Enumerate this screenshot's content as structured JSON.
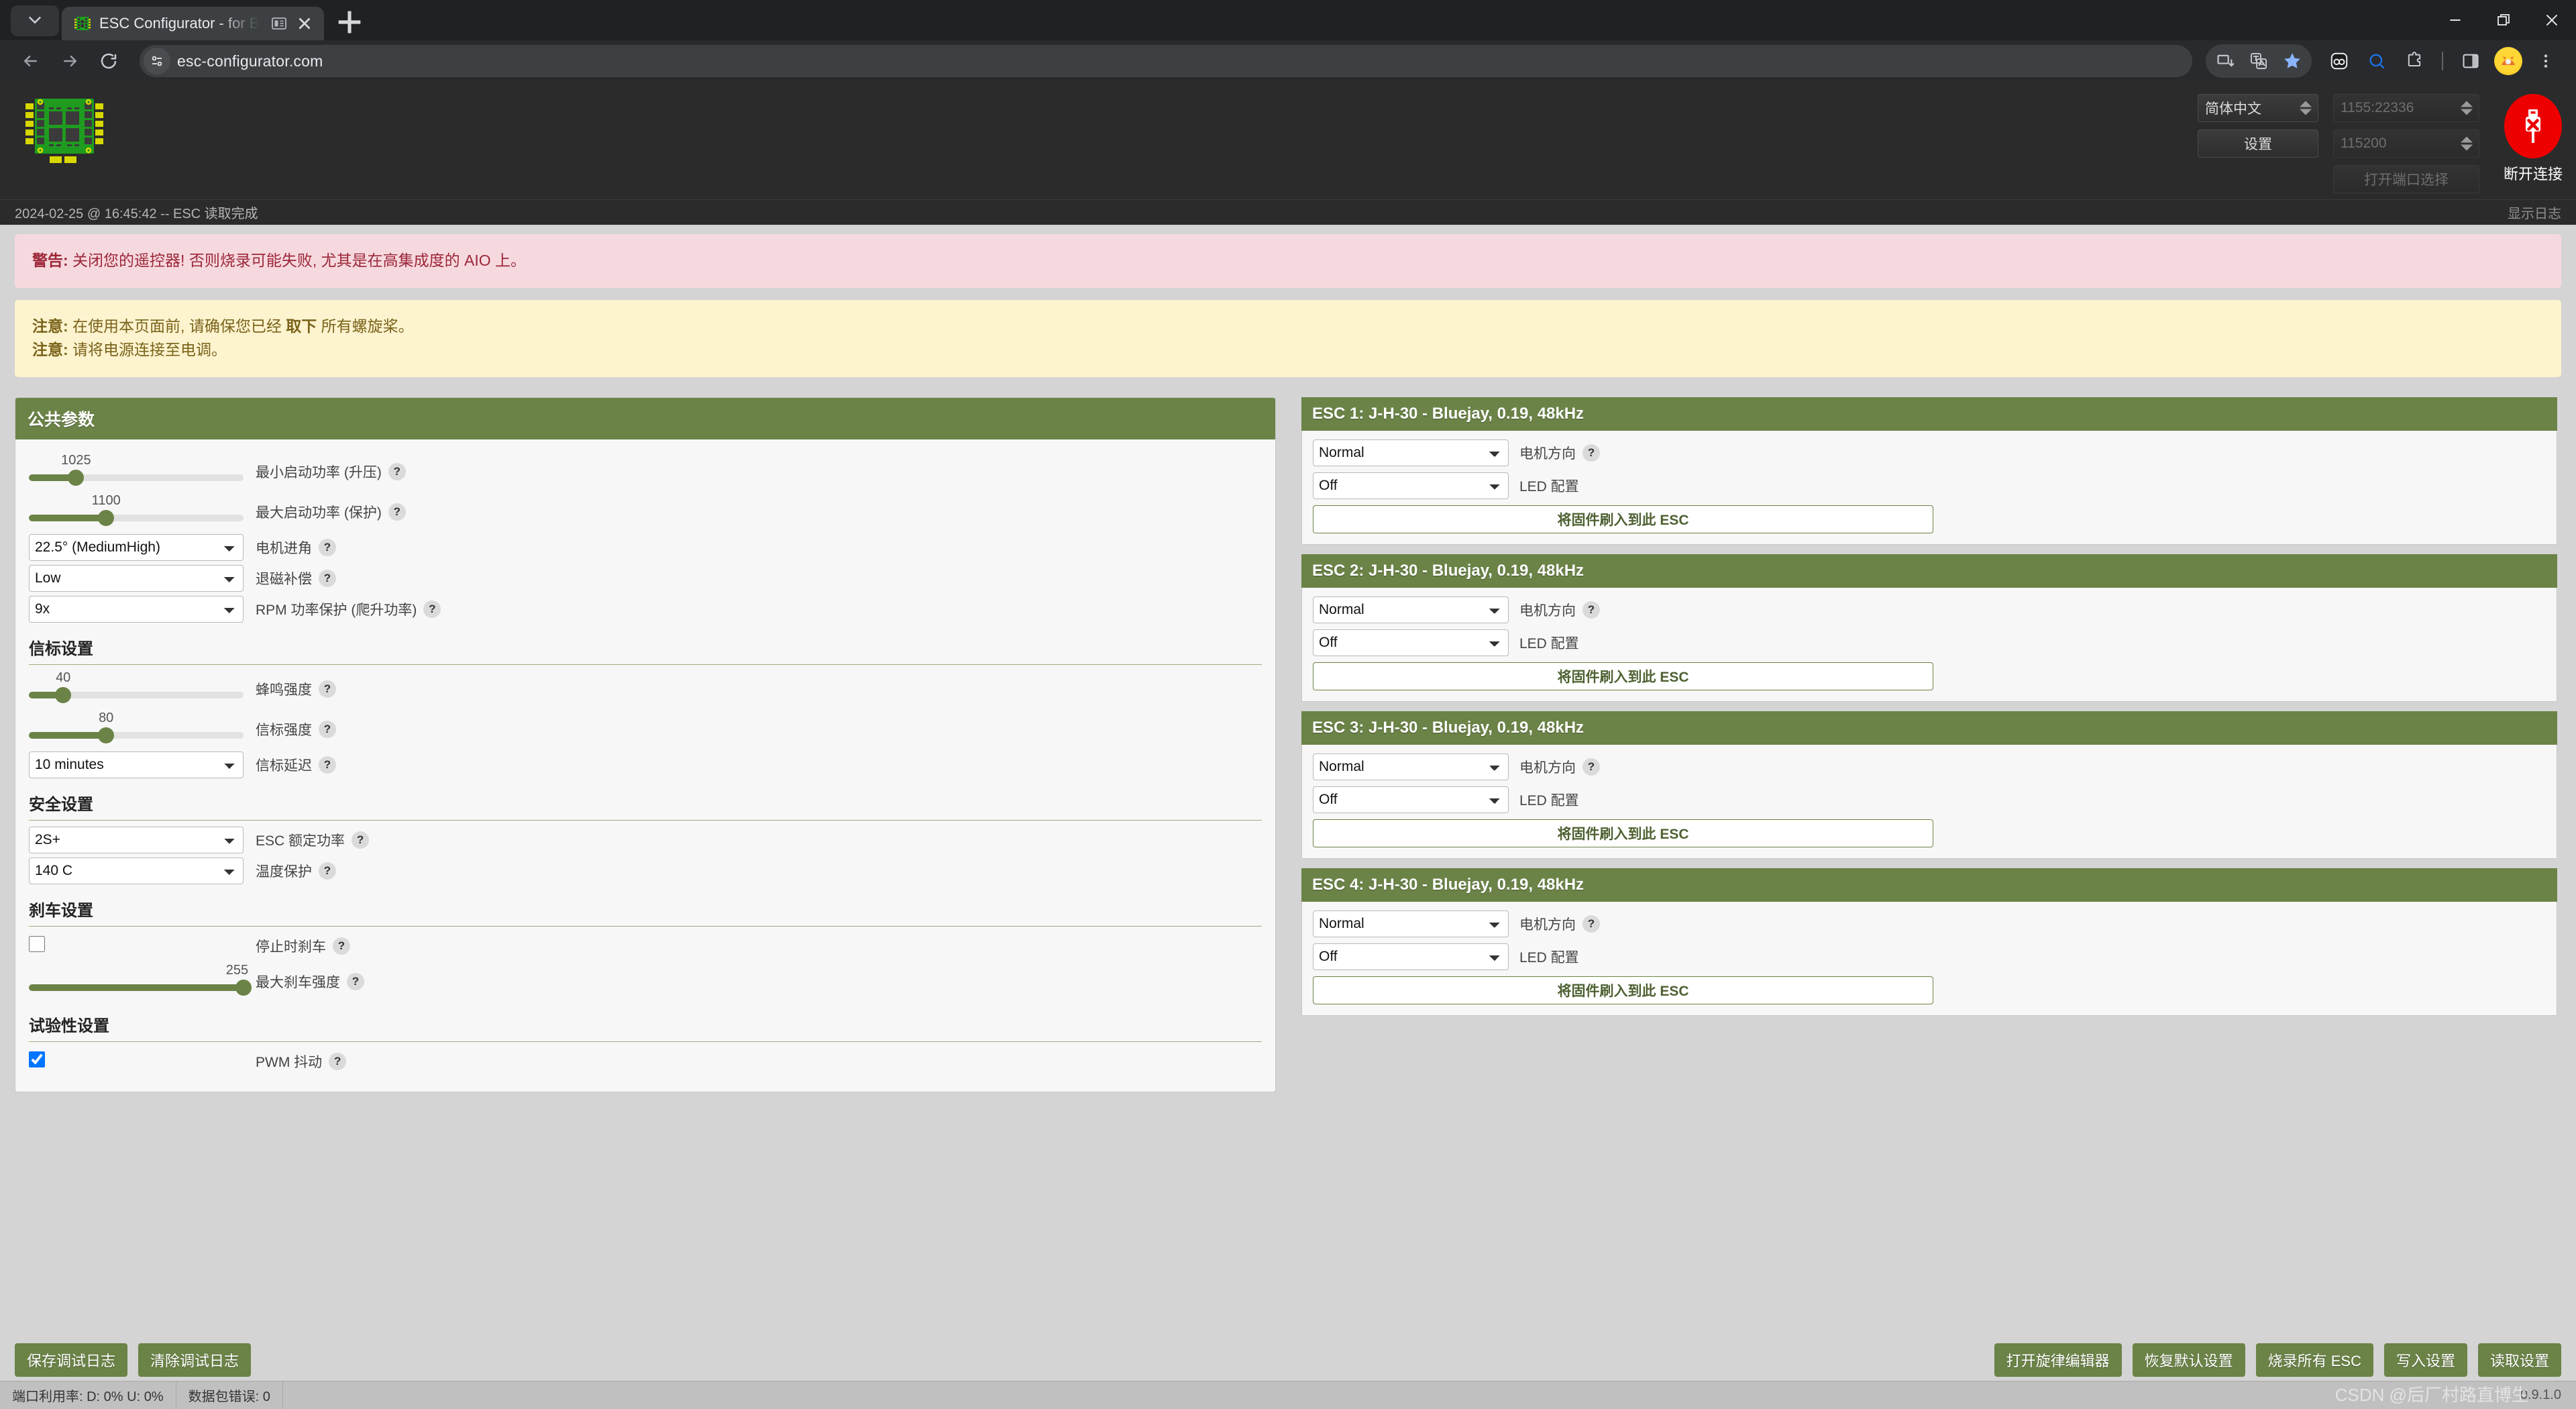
{
  "browser": {
    "tab_title": "ESC Configurator - for Bl",
    "url": "esc-configurator.com",
    "new_tab_label": "+",
    "icons": {
      "tab_chevron": "chevron-down-icon",
      "back": "back-arrow-icon",
      "forward": "forward-arrow-icon",
      "reload": "reload-icon",
      "site_info": "site-settings-icon",
      "minimize": "minimize-icon",
      "maximize": "maximize-icon",
      "close": "close-icon"
    }
  },
  "header": {
    "language_select": "简体中文",
    "settings_button": "设置",
    "port_select": "1155:22336",
    "baud_select": "115200",
    "port_picker_button": "打开端口选择",
    "connect_label": "断开连接",
    "connect_color": "#ee0000"
  },
  "logbar": {
    "last_message": "2024-02-25 @ 16:45:42 -- ESC 读取完成",
    "show_log": "显示日志"
  },
  "banners": {
    "danger": {
      "strong": "警告:",
      "text": " 关闭您的遥控器! 否则烧录可能失败, 尤其是在高集成度的 AIO 上。"
    },
    "warn_lines": [
      {
        "strong": "注意:",
        "pre": " 在使用本页面前, 请确保您已经 ",
        "bold": "取下",
        "post": " 所有螺旋桨。"
      },
      {
        "strong": "注意:",
        "pre": " 请将电源连接至电调。",
        "bold": "",
        "post": ""
      }
    ]
  },
  "common": {
    "title": "公共参数",
    "sliders_top": [
      {
        "label": "最小启动功率 (升压)",
        "value": "1025",
        "percent": 22
      },
      {
        "label": "最大启动功率 (保护)",
        "value": "1100",
        "percent": 36
      }
    ],
    "selects_top": [
      {
        "label": "电机进角",
        "value": "22.5° (MediumHigh)",
        "help": true
      },
      {
        "label": "退磁补偿",
        "value": "Low",
        "help": true
      },
      {
        "label": "RPM 功率保护 (爬升功率)",
        "value": "9x",
        "help": true
      }
    ],
    "beacon": {
      "title": "信标设置",
      "sliders": [
        {
          "label": "蜂鸣强度",
          "value": "40",
          "percent": 16
        },
        {
          "label": "信标强度",
          "value": "80",
          "percent": 36
        }
      ],
      "select": {
        "label": "信标延迟",
        "value": "10 minutes"
      }
    },
    "safety": {
      "title": "安全设置",
      "selects": [
        {
          "label": "ESC 额定功率",
          "value": "2S+"
        },
        {
          "label": "温度保护",
          "value": "140 C"
        }
      ]
    },
    "brake": {
      "title": "刹车设置",
      "checkbox": {
        "label": "停止时刹车",
        "checked": false
      },
      "slider": {
        "label": "最大刹车强度",
        "value": "255",
        "percent": 100
      }
    },
    "experimental": {
      "title": "试验性设置",
      "checkbox": {
        "label": "PWM 抖动",
        "checked": true
      }
    }
  },
  "escs": [
    {
      "title": "ESC 1: J-H-30 - Bluejay, 0.19, 48kHz",
      "direction_label": "电机方向",
      "direction_value": "Normal",
      "led_label": "LED 配置",
      "led_value": "Off",
      "flash_label": "将固件刷入到此 ESC"
    },
    {
      "title": "ESC 2: J-H-30 - Bluejay, 0.19, 48kHz",
      "direction_label": "电机方向",
      "direction_value": "Normal",
      "led_label": "LED 配置",
      "led_value": "Off",
      "flash_label": "将固件刷入到此 ESC"
    },
    {
      "title": "ESC 3: J-H-30 - Bluejay, 0.19, 48kHz",
      "direction_label": "电机方向",
      "direction_value": "Normal",
      "led_label": "LED 配置",
      "led_value": "Off",
      "flash_label": "将固件刷入到此 ESC"
    },
    {
      "title": "ESC 4: J-H-30 - Bluejay, 0.19, 48kHz",
      "direction_label": "电机方向",
      "direction_value": "Normal",
      "led_label": "LED 配置",
      "led_value": "Off",
      "flash_label": "将固件刷入到此 ESC"
    }
  ],
  "footer": {
    "left_buttons": [
      "保存调试日志",
      "清除调试日志"
    ],
    "right_buttons": [
      "打开旋律编辑器",
      "恢复默认设置",
      "烧录所有 ESC",
      "写入设置",
      "读取设置"
    ]
  },
  "status": {
    "port_usage": "端口利用率:  D: 0% U: 0%",
    "packet_error": "数据包错误: 0",
    "version": "0.9.1.0",
    "watermark": "CSDN @后厂村路直博生"
  },
  "accent": "#6b8347"
}
